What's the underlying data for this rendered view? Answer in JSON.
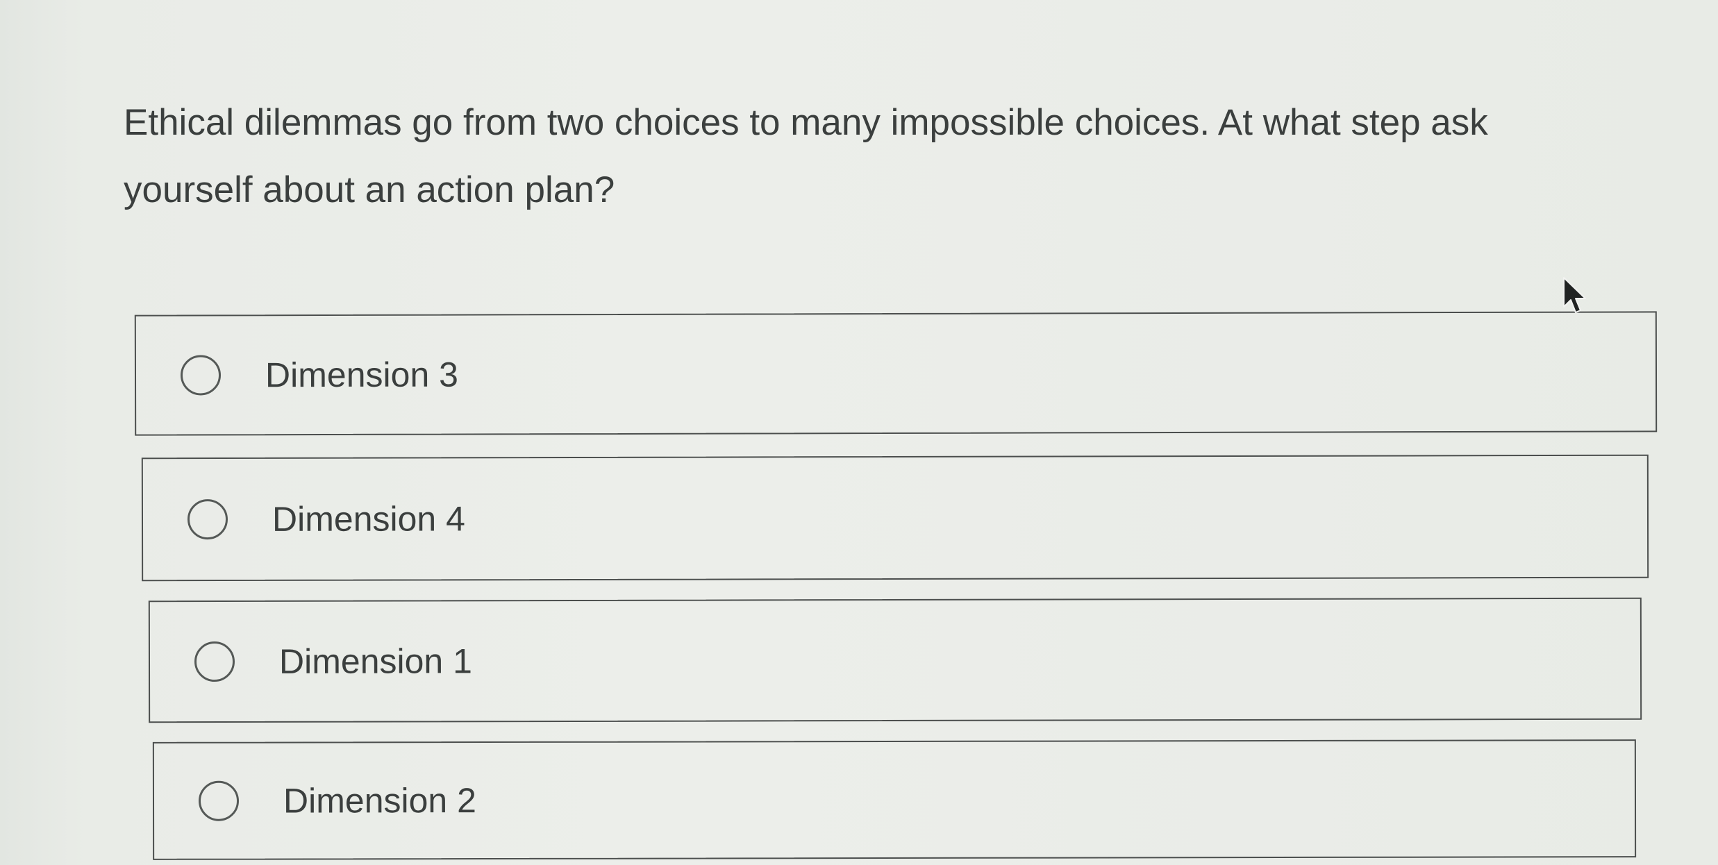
{
  "question": {
    "text": "Ethical dilemmas go from two choices to many impossible choices. At what step ask yourself about an action plan?"
  },
  "choices": [
    {
      "label": "Dimension 3"
    },
    {
      "label": "Dimension 4"
    },
    {
      "label": "Dimension 1"
    },
    {
      "label": "Dimension 2"
    }
  ],
  "icons": {
    "radio": "radio-button-unselected-icon",
    "cursor": "mouse-pointer-icon"
  }
}
